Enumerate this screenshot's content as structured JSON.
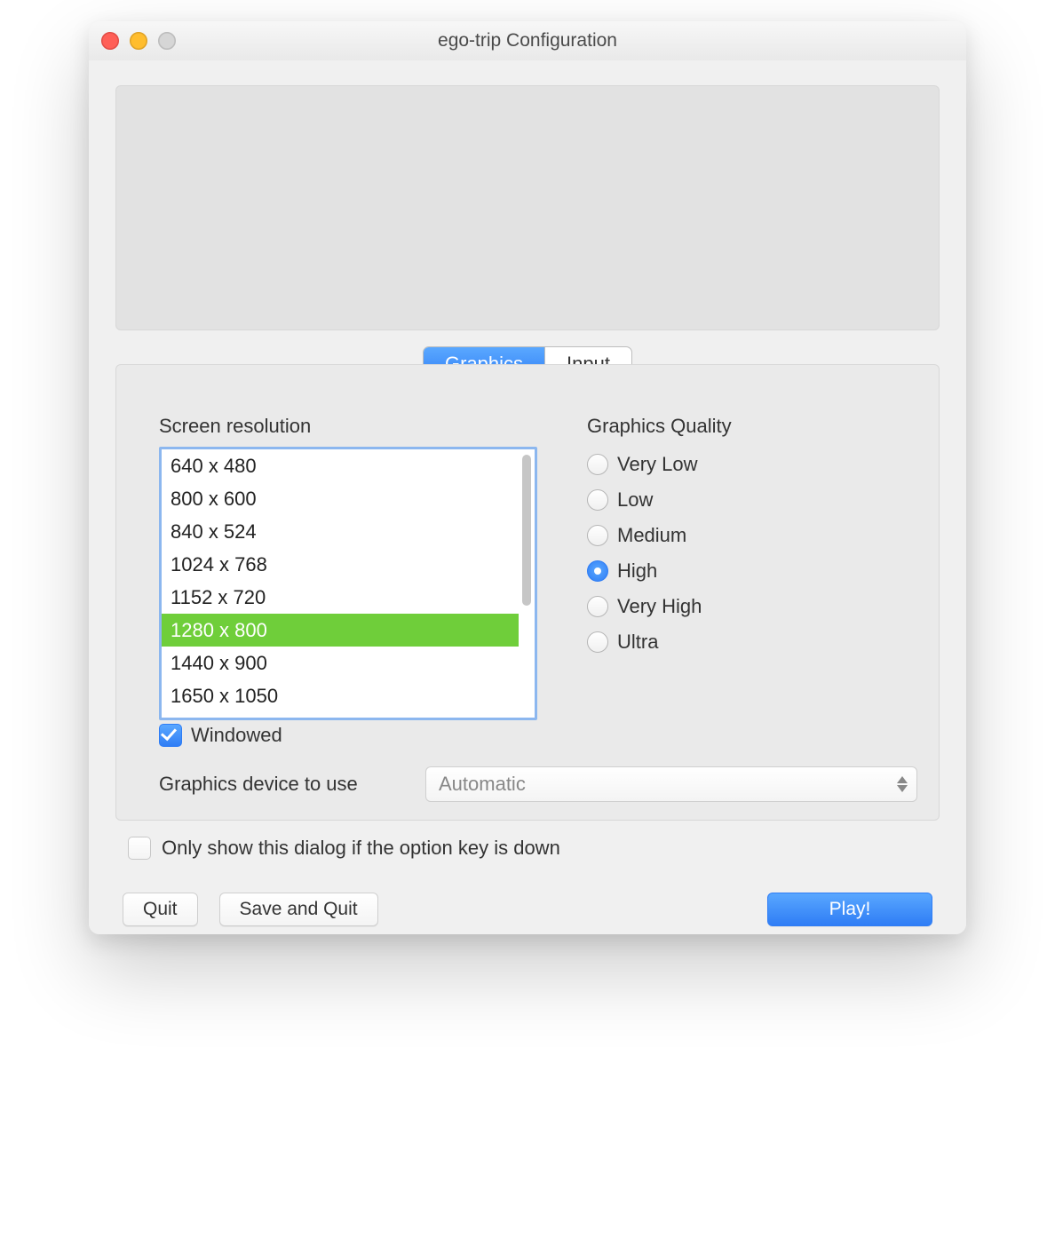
{
  "window": {
    "title": "ego-trip Configuration"
  },
  "tabs": [
    {
      "label": "Graphics",
      "active": true
    },
    {
      "label": "Input",
      "active": false
    }
  ],
  "resolution": {
    "label": "Screen resolution",
    "items": [
      "640 x 480",
      "800 x 600",
      "840 x 524",
      "1024 x 768",
      "1152 x 720",
      "1280 x 800",
      "1440 x 900",
      "1650 x 1050"
    ],
    "selected_index": 5
  },
  "quality": {
    "label": "Graphics Quality",
    "options": [
      "Very Low",
      "Low",
      "Medium",
      "High",
      "Very High",
      "Ultra"
    ],
    "selected_index": 3
  },
  "windowed": {
    "label": "Windowed",
    "checked": true
  },
  "device": {
    "label": "Graphics device to use",
    "value": "Automatic"
  },
  "optionkey": {
    "label": "Only show this dialog if the option key is down",
    "checked": false
  },
  "buttons": {
    "quit": "Quit",
    "save_quit": "Save and Quit",
    "play": "Play!"
  }
}
